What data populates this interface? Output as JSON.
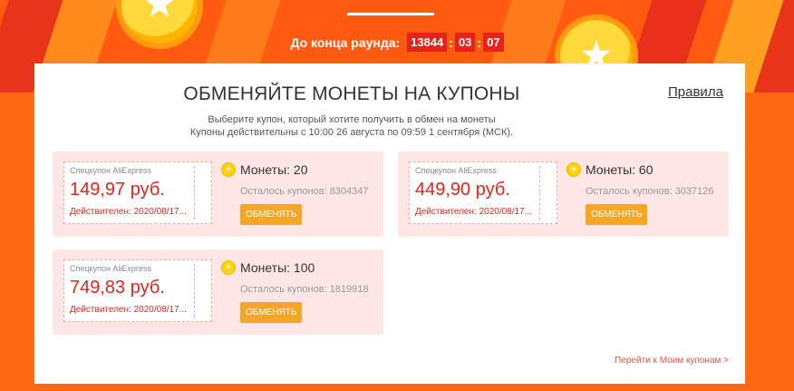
{
  "header": {
    "timer_label": "До конца раунда:",
    "timer": {
      "part1": "13844",
      "part2": "03",
      "part3": "07"
    }
  },
  "main": {
    "title": "ОБМЕНЯЙТЕ МОНЕТЫ НА КУПОНЫ",
    "rules_link": "Правила",
    "subtitle_line1": "Выберите купон, который хотите получить в обмен на монеты",
    "subtitle_line2": "Купоны действительны с 10:00 26 августа по 09:59 1 сентября (МСК).",
    "coupons": [
      {
        "brand": "Спецкупон AliExpress",
        "price": "149,97 руб.",
        "valid": "Действителен: 2020/08/17...",
        "coins": "Монеты: 20",
        "remaining": "Осталось купонов: 8304347",
        "button": "ОБМЕНЯТЬ"
      },
      {
        "brand": "Спецкупон AliExpress",
        "price": "449,90 руб.",
        "valid": "Действителен: 2020/08/17...",
        "coins": "Монеты: 60",
        "remaining": "Осталось купонов: 3037126",
        "button": "ОБМЕНЯТЬ"
      },
      {
        "brand": "Спецкупон AliExpress",
        "price": "749,83 руб.",
        "valid": "Действителен: 2020/08/17...",
        "coins": "Монеты: 100",
        "remaining": "Осталось купонов: 1819918",
        "button": "ОБМЕНЯТЬ"
      }
    ],
    "my_coupons_link": "Перейти к Моим купонам >"
  },
  "colors": {
    "accent": "#e8221b",
    "button": "#f5a623",
    "card_bg": "#fde6e4",
    "page_bg": "#ff6a12"
  }
}
